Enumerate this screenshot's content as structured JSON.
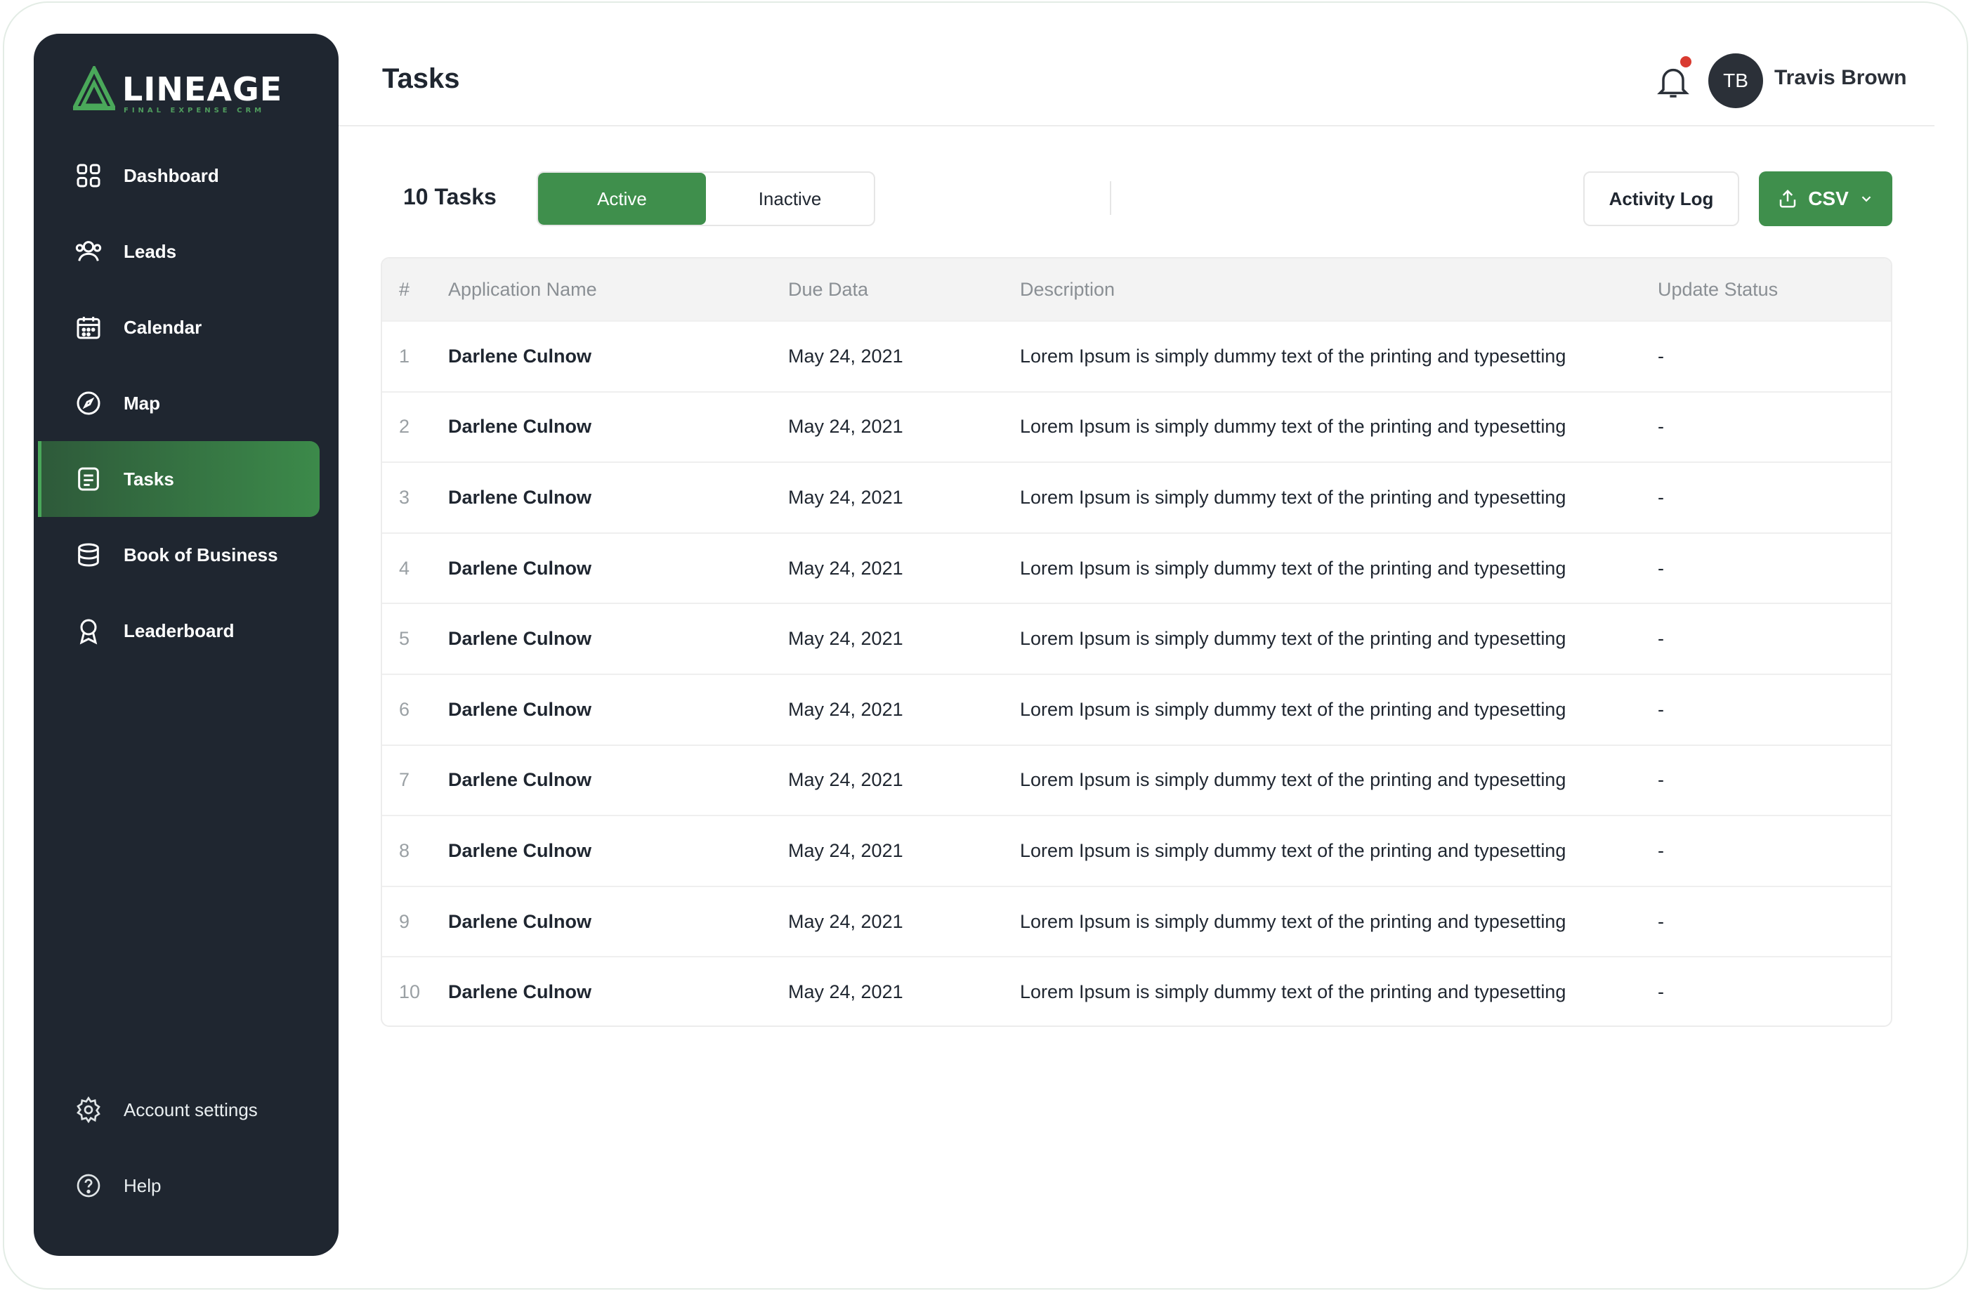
{
  "brand": {
    "name": "LINEAGE",
    "tagline": "FINAL EXPENSE CRM"
  },
  "sidebar": {
    "items": [
      {
        "label": "Dashboard",
        "icon": "grid-icon"
      },
      {
        "label": "Leads",
        "icon": "users-icon"
      },
      {
        "label": "Calendar",
        "icon": "calendar-icon"
      },
      {
        "label": "Map",
        "icon": "compass-icon"
      },
      {
        "label": "Tasks",
        "icon": "document-icon",
        "active": true
      },
      {
        "label": "Book of Business",
        "icon": "briefcase-icon"
      },
      {
        "label": "Leaderboard",
        "icon": "award-icon"
      }
    ],
    "bottom": [
      {
        "label": "Account settings",
        "icon": "gear-icon"
      },
      {
        "label": "Help",
        "icon": "help-icon"
      }
    ]
  },
  "header": {
    "title": "Tasks",
    "user": {
      "initials": "TB",
      "name": "Travis Brown"
    }
  },
  "toolbar": {
    "task_count": "10 Tasks",
    "filters": [
      "Active",
      "Inactive"
    ],
    "selected_filter": "Active",
    "activity_log_label": "Activity Log",
    "csv_label": "CSV"
  },
  "table": {
    "columns": [
      "#",
      "Application Name",
      "Due Data",
      "Description",
      "Update Status"
    ],
    "rows": [
      {
        "num": "1",
        "name": "Darlene Culnow",
        "due": "May 24, 2021",
        "desc": "Lorem Ipsum is simply dummy text of the printing and typesetting",
        "status": "-"
      },
      {
        "num": "2",
        "name": "Darlene Culnow",
        "due": "May 24, 2021",
        "desc": "Lorem Ipsum is simply dummy text of the printing and typesetting",
        "status": "-"
      },
      {
        "num": "3",
        "name": "Darlene Culnow",
        "due": "May 24, 2021",
        "desc": "Lorem Ipsum is simply dummy text of the printing and typesetting",
        "status": "-"
      },
      {
        "num": "4",
        "name": "Darlene Culnow",
        "due": "May 24, 2021",
        "desc": "Lorem Ipsum is simply dummy text of the printing and typesetting",
        "status": "-"
      },
      {
        "num": "5",
        "name": "Darlene Culnow",
        "due": "May 24, 2021",
        "desc": "Lorem Ipsum is simply dummy text of the printing and typesetting",
        "status": "-"
      },
      {
        "num": "6",
        "name": "Darlene Culnow",
        "due": "May 24, 2021",
        "desc": "Lorem Ipsum is simply dummy text of the printing and typesetting",
        "status": "-"
      },
      {
        "num": "7",
        "name": "Darlene Culnow",
        "due": "May 24, 2021",
        "desc": "Lorem Ipsum is simply dummy text of the printing and typesetting",
        "status": "-"
      },
      {
        "num": "8",
        "name": "Darlene Culnow",
        "due": "May 24, 2021",
        "desc": "Lorem Ipsum is simply dummy text of the printing and typesetting",
        "status": "-"
      },
      {
        "num": "9",
        "name": "Darlene Culnow",
        "due": "May 24, 2021",
        "desc": "Lorem Ipsum is simply dummy text of the printing and typesetting",
        "status": "-"
      },
      {
        "num": "10",
        "name": "Darlene Culnow",
        "due": "May 24, 2021",
        "desc": "Lorem Ipsum is simply dummy text of the printing and typesetting",
        "status": "-"
      }
    ]
  },
  "colors": {
    "accent": "#3f8f4c",
    "sidebar_bg": "#1f2630",
    "notification_dot": "#d93a30"
  }
}
